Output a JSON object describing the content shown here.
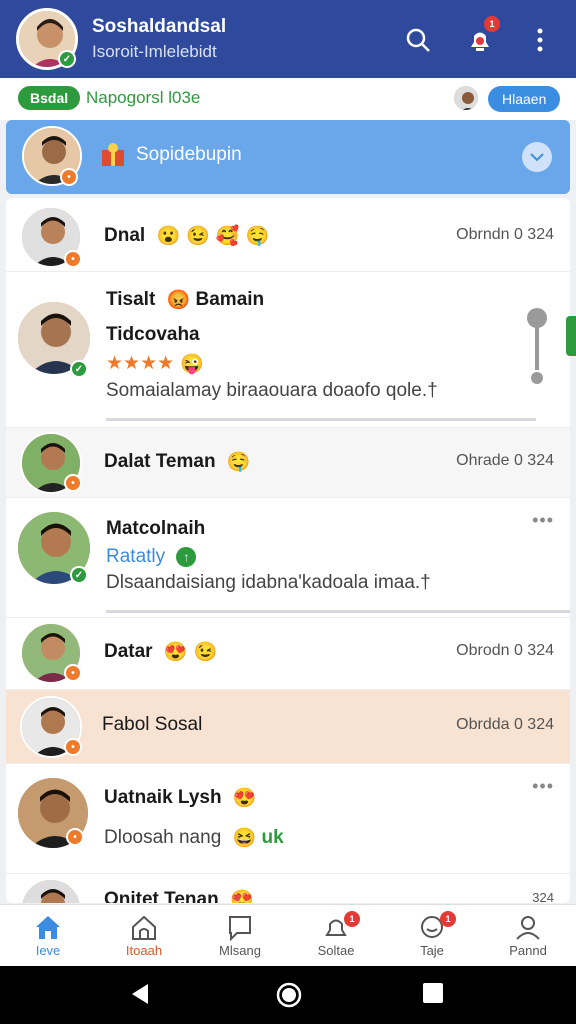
{
  "header": {
    "title": "Soshaldandsal",
    "subtitle": "Isoroit-Imlelebidt",
    "notif_count": "1"
  },
  "strip": {
    "pill_label": "Bsdal",
    "status_text": "Napogorsl l03e",
    "blue_pill": "Hlaaen"
  },
  "pinned": {
    "title": "Sopidebupin"
  },
  "rows": [
    {
      "name": "Dnal",
      "meta": "Obrndn 0 324"
    },
    {
      "name": "Tisalt",
      "name2": "Bamain",
      "subtitle": "Tidcovaha",
      "stars": "★★★★",
      "message": "Somaialamay biraaouara doaofo qole.†",
      "progress": 0.0
    },
    {
      "name": "Dalat Teman",
      "meta": "Ohrade 0 324"
    },
    {
      "name": "Matcolnaih",
      "subtitle": "Ratatly",
      "message": "Dlsaandaisiang idabna'kadoala imaa.†",
      "progress": 0.93
    },
    {
      "name": "Datar",
      "meta": "Obrodn 0 324"
    },
    {
      "name": "Fabol Sosal",
      "meta": "Obrdda 0 324"
    },
    {
      "name": "Uatnaik Lysh",
      "message": "Dloosah nang",
      "suffix": "uk"
    },
    {
      "name": "Onitet Tenan",
      "meta": "324"
    }
  ],
  "nav": [
    {
      "label": "Ieve"
    },
    {
      "label": "Itoaah"
    },
    {
      "label": "Mlsang"
    },
    {
      "label": "Soltae",
      "badge": "1"
    },
    {
      "label": "Taje",
      "badge": "1"
    },
    {
      "label": "Pannd"
    }
  ],
  "colors": {
    "header": "#2f4a9c",
    "accent": "#3a8de0",
    "green": "#2e9a3e",
    "orange": "#ef7a2a"
  }
}
